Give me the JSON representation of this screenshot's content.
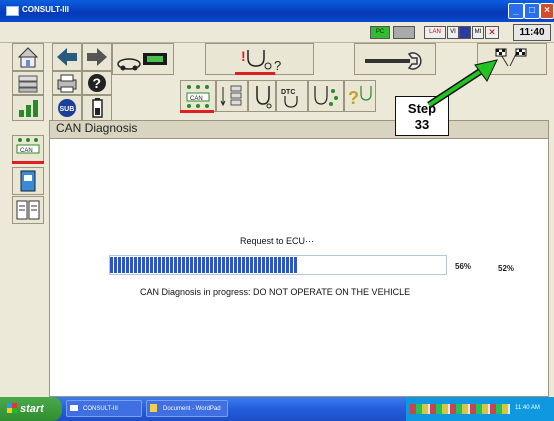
{
  "window": {
    "title": "CONSULT-III",
    "min_glyph": "_",
    "max_glyph": "□",
    "close_glyph": "×"
  },
  "status": {
    "pc_label": "PC",
    "lan_label": "LAN",
    "vi_label": "VI",
    "mi_label": "MI",
    "clock": "11:40"
  },
  "panel": {
    "title": "CAN Diagnosis"
  },
  "tabs": {
    "can_label": "CAN",
    "dtc_label": "DTC"
  },
  "callout": {
    "step_line1": "Step",
    "step_line2": "33"
  },
  "progress": {
    "request_text": "Request to ECU···",
    "fraction": 0.56,
    "inner_percent": "56%",
    "outer_percent": "52%",
    "status_text": "CAN Diagnosis in progress: DO NOT OPERATE ON THE VEHICLE"
  },
  "taskbar": {
    "start_label": "start",
    "tasks": [
      "CONSULT-III",
      "Document - WordPad"
    ],
    "clock": "11:40 AM"
  },
  "colors": {
    "accent": "#2e55c8",
    "arrow": "#22c422",
    "alert": "#e02020"
  }
}
